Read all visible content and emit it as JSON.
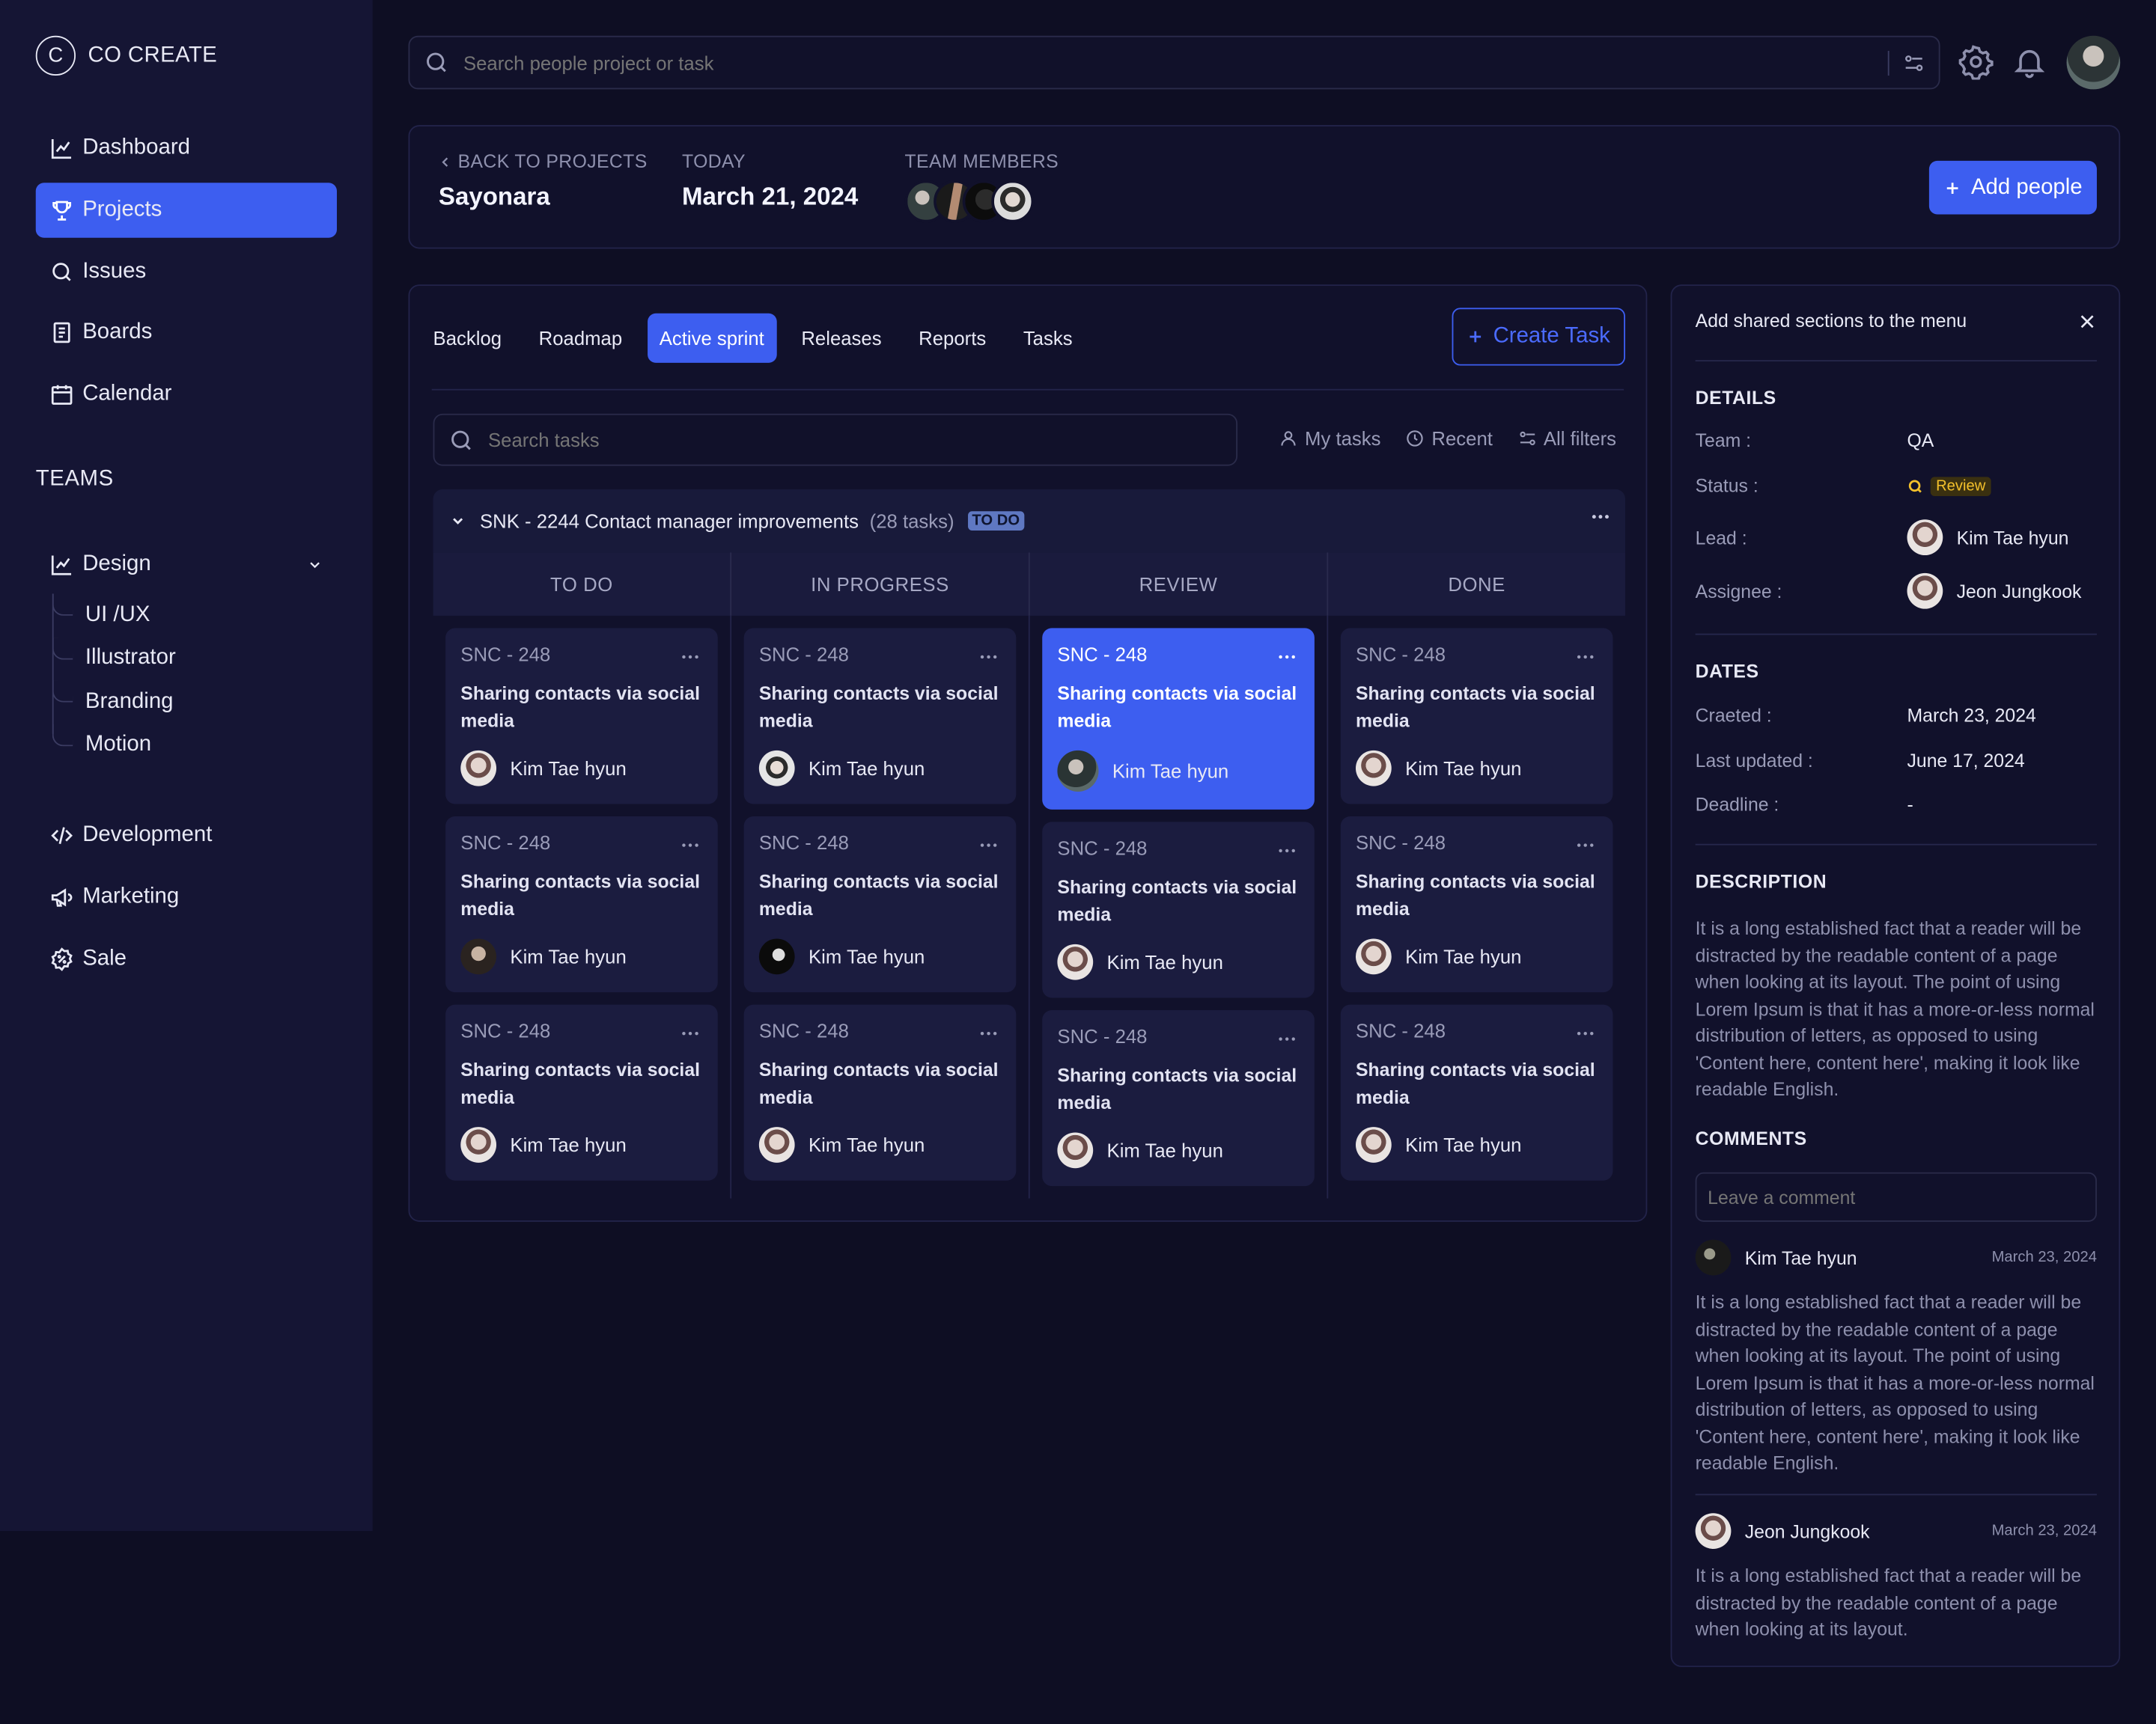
{
  "app": {
    "logo_letter": "C",
    "name": "CO CREATE"
  },
  "sidebar": {
    "items": [
      {
        "label": "Dashboard",
        "icon": "chart-line-icon"
      },
      {
        "label": "Projects",
        "icon": "trophy-icon",
        "active": true
      },
      {
        "label": "Issues",
        "icon": "search-icon"
      },
      {
        "label": "Boards",
        "icon": "document-icon"
      },
      {
        "label": "Calendar",
        "icon": "calendar-icon"
      }
    ],
    "teams_title": "TEAMS",
    "design": {
      "label": "Design",
      "children": [
        "UI /UX",
        "Illustrator",
        "Branding",
        "Motion"
      ]
    },
    "other_teams": [
      {
        "label": "Development",
        "icon": "code-icon"
      },
      {
        "label": "Marketing",
        "icon": "megaphone-icon"
      },
      {
        "label": "Sale",
        "icon": "discount-icon"
      }
    ]
  },
  "topbar": {
    "search_placeholder": "Search people project or task"
  },
  "header": {
    "back_label": "BACK TO PROJECTS",
    "project_name": "Sayonara",
    "today_label": "TODAY",
    "today_value": "March 21, 2024",
    "team_label": "TEAM MEMBERS",
    "add_people": "Add people"
  },
  "board": {
    "tabs": [
      "Backlog",
      "Roadmap",
      "Active sprint",
      "Releases",
      "Reports",
      "Tasks"
    ],
    "active_tab": "Active sprint",
    "create_task": "Create Task",
    "search_placeholder": "Search tasks",
    "filters": [
      "My tasks",
      "Recent",
      "All filters"
    ],
    "group": {
      "title": "SNK - 2244 Contact manager improvements",
      "count": "(28 tasks)",
      "status": "TO DO"
    },
    "columns": [
      {
        "name": "TO DO",
        "cards": [
          {
            "id": "SNC - 248",
            "title": "Sharing contacts via social media",
            "assignee": "Kim Tae hyun"
          },
          {
            "id": "SNC - 248",
            "title": "Sharing contacts via social media",
            "assignee": "Kim Tae hyun"
          },
          {
            "id": "SNC - 248",
            "title": "Sharing contacts via social media",
            "assignee": "Kim Tae hyun"
          }
        ]
      },
      {
        "name": "IN PROGRESS",
        "cards": [
          {
            "id": "SNC - 248",
            "title": "Sharing contacts via social media",
            "assignee": "Kim Tae hyun"
          },
          {
            "id": "SNC - 248",
            "title": "Sharing contacts via social media",
            "assignee": "Kim Tae hyun"
          },
          {
            "id": "SNC - 248",
            "title": "Sharing contacts via social media",
            "assignee": "Kim Tae hyun"
          }
        ]
      },
      {
        "name": "REVIEW",
        "cards": [
          {
            "id": "SNC - 248",
            "title": "Sharing contacts via social media",
            "assignee": "Kim Tae hyun",
            "highlighted": true
          },
          {
            "id": "SNC - 248",
            "title": "Sharing contacts via social media",
            "assignee": "Kim Tae hyun"
          },
          {
            "id": "SNC - 248",
            "title": "Sharing contacts via social media",
            "assignee": "Kim Tae hyun"
          }
        ]
      },
      {
        "name": "DONE",
        "cards": [
          {
            "id": "SNC - 248",
            "title": "Sharing contacts via social media",
            "assignee": "Kim Tae hyun"
          },
          {
            "id": "SNC - 248",
            "title": "Sharing contacts via social media",
            "assignee": "Kim Tae hyun"
          },
          {
            "id": "SNC - 248",
            "title": "Sharing contacts via social media",
            "assignee": "Kim Tae hyun"
          }
        ]
      }
    ]
  },
  "detail": {
    "heading": "Add shared sections to the menu",
    "details_title": "DETAILS",
    "team_label": "Team :",
    "team_value": "QA",
    "status_label": "Status :",
    "status_value": "Review",
    "lead_label": "Lead :",
    "lead_value": "Kim Tae hyun",
    "assignee_label": "Assignee :",
    "assignee_value": "Jeon Jungkook",
    "dates_title": "DATES",
    "created_label": "Craeted :",
    "created_value": "March 23, 2024",
    "updated_label": "Last updated :",
    "updated_value": "June 17, 2024",
    "deadline_label": "Deadline :",
    "deadline_value": "-",
    "description_title": "DESCRIPTION",
    "description": "It is a long established fact that a reader will be distracted by the readable content of a page when looking at its layout. The point of using Lorem Ipsum is that it has a more-or-less normal distribution of letters, as opposed to using 'Content here, content here', making it look like readable English.",
    "comments_title": "COMMENTS",
    "comment_placeholder": "Leave a comment",
    "comments": [
      {
        "author": "Kim Tae hyun",
        "date": "March 23, 2024",
        "text": "It is a long established fact that a reader will be distracted by the readable content of a page when looking at its layout. The point of using Lorem Ipsum is that it has a more-or-less normal distribution of letters, as opposed to using 'Content here, content here', making it look like readable English."
      },
      {
        "author": "Jeon Jungkook",
        "date": "March 23, 2024",
        "text": "It is a long established fact that a reader will be distracted by the readable content of a page when looking at its layout."
      }
    ]
  },
  "colors": {
    "accent": "#3d5ef0",
    "background": "#0e0e23",
    "sidebar": "#151534",
    "review": "#f3c02b"
  }
}
